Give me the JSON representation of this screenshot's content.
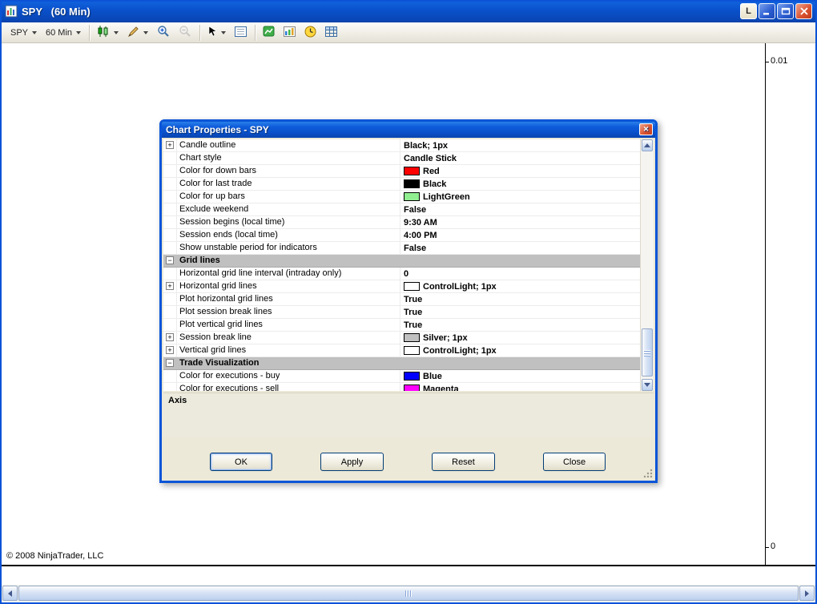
{
  "window": {
    "title": "SPY   (60 Min)",
    "link_button_label": "L"
  },
  "toolbar": {
    "instrument_label": "SPY",
    "interval_label": "60 Min",
    "icons": [
      "candlestick-icon",
      "pencil-icon",
      "zoom-in-icon",
      "zoom-out-icon",
      "cursor-icon",
      "data-box-icon",
      "indicators-icon",
      "chart-image-icon",
      "clock-icon",
      "data-grid-icon"
    ]
  },
  "chart": {
    "axis_top": "0.01",
    "axis_bottom": "0",
    "copyright": "© 2008 NinjaTrader, LLC"
  },
  "dialog": {
    "title": "Chart Properties - SPY",
    "description_title": "Axis",
    "buttons": {
      "ok": "OK",
      "apply": "Apply",
      "reset": "Reset",
      "close": "Close"
    },
    "rows": [
      {
        "kind": "prop",
        "expand": "+",
        "label": "Candle outline",
        "value": "Black; 1px"
      },
      {
        "kind": "prop",
        "label": "Chart style",
        "value": "Candle Stick"
      },
      {
        "kind": "prop",
        "label": "Color for down bars",
        "swatch": "#FF0000",
        "value": "Red"
      },
      {
        "kind": "prop",
        "label": "Color for last trade",
        "swatch": "#000000",
        "value": "Black"
      },
      {
        "kind": "prop",
        "label": "Color for up bars",
        "swatch": "#90EE90",
        "value": "LightGreen"
      },
      {
        "kind": "prop",
        "label": "Exclude weekend",
        "value": "False"
      },
      {
        "kind": "prop",
        "label": "Session begins (local time)",
        "value": "9:30 AM"
      },
      {
        "kind": "prop",
        "label": "Session ends (local time)",
        "value": "4:00 PM"
      },
      {
        "kind": "prop",
        "label": "Show unstable period for indicators",
        "value": "False"
      },
      {
        "kind": "category",
        "expand": "-",
        "label": "Grid lines"
      },
      {
        "kind": "prop",
        "label": "Horizontal grid line interval (intraday only)",
        "value": "0"
      },
      {
        "kind": "prop",
        "expand": "+",
        "label": "Horizontal grid lines",
        "swatch": "#FFFFFF",
        "value": "ControlLight; 1px"
      },
      {
        "kind": "prop",
        "label": "Plot horizontal grid lines",
        "value": "True"
      },
      {
        "kind": "prop",
        "label": "Plot session break lines",
        "value": "True"
      },
      {
        "kind": "prop",
        "label": "Plot vertical grid lines",
        "value": "True"
      },
      {
        "kind": "prop",
        "expand": "+",
        "label": "Session break line",
        "swatch": "#C0C0C0",
        "value": "Silver; 1px"
      },
      {
        "kind": "prop",
        "expand": "+",
        "label": "Vertical grid lines",
        "swatch": "#FFFFFF",
        "value": "ControlLight; 1px"
      },
      {
        "kind": "category",
        "expand": "-",
        "label": "Trade Visualization"
      },
      {
        "kind": "prop",
        "label": "Color for executions - buy",
        "swatch": "#0000FF",
        "value": "Blue"
      },
      {
        "kind": "prop",
        "label": "Color for executions - sell",
        "swatch": "#FF00FF",
        "value": "Magenta"
      }
    ]
  }
}
